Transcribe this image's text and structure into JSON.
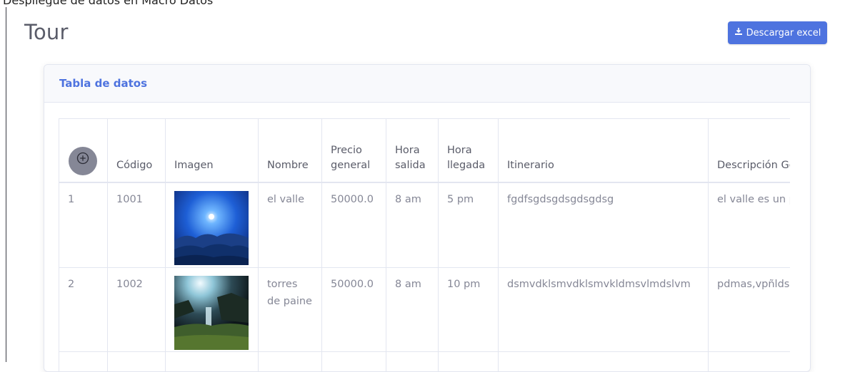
{
  "page": {
    "title": "Tour",
    "top_text": "Despliegue de datos en Macro Datos"
  },
  "toolbar": {
    "download_excel_label": "Descargar excel",
    "download_icon": "download-icon"
  },
  "card": {
    "header": "Tabla de datos"
  },
  "table": {
    "add_icon": "plus-circle-icon",
    "headers": {
      "codigo": "Código",
      "imagen": "Imagen",
      "nombre": "Nombre",
      "precio": "Precio general",
      "hora_salida": "Hora salida",
      "hora_llegada": "Hora llegada",
      "itinerario": "Itinerario",
      "descripcion": "Descripción Ge"
    },
    "rows": [
      {
        "index": "1",
        "codigo": "1001",
        "image": "night-valley-landscape",
        "nombre": "el valle",
        "precio": "50000.0",
        "hora_salida": "8 am",
        "hora_llegada": "5 pm",
        "itinerario": "fgdfsgdsgdsgdsgdsg",
        "descripcion": "el valle es un p"
      },
      {
        "index": "2",
        "codigo": "1002",
        "image": "waterfall-landscape",
        "nombre": "torres de paine",
        "precio": "50000.0",
        "hora_salida": "8 am",
        "hora_llegada": "10 pm",
        "itinerario": "dsmvdklsmvdklsmvkldmsvlmdslvm",
        "descripcion": "pdmas,vpñldsn"
      }
    ]
  },
  "colors": {
    "primary": "#4e73df",
    "text": "#858796",
    "heading": "#5a5c69",
    "border": "#e3e6f0"
  }
}
